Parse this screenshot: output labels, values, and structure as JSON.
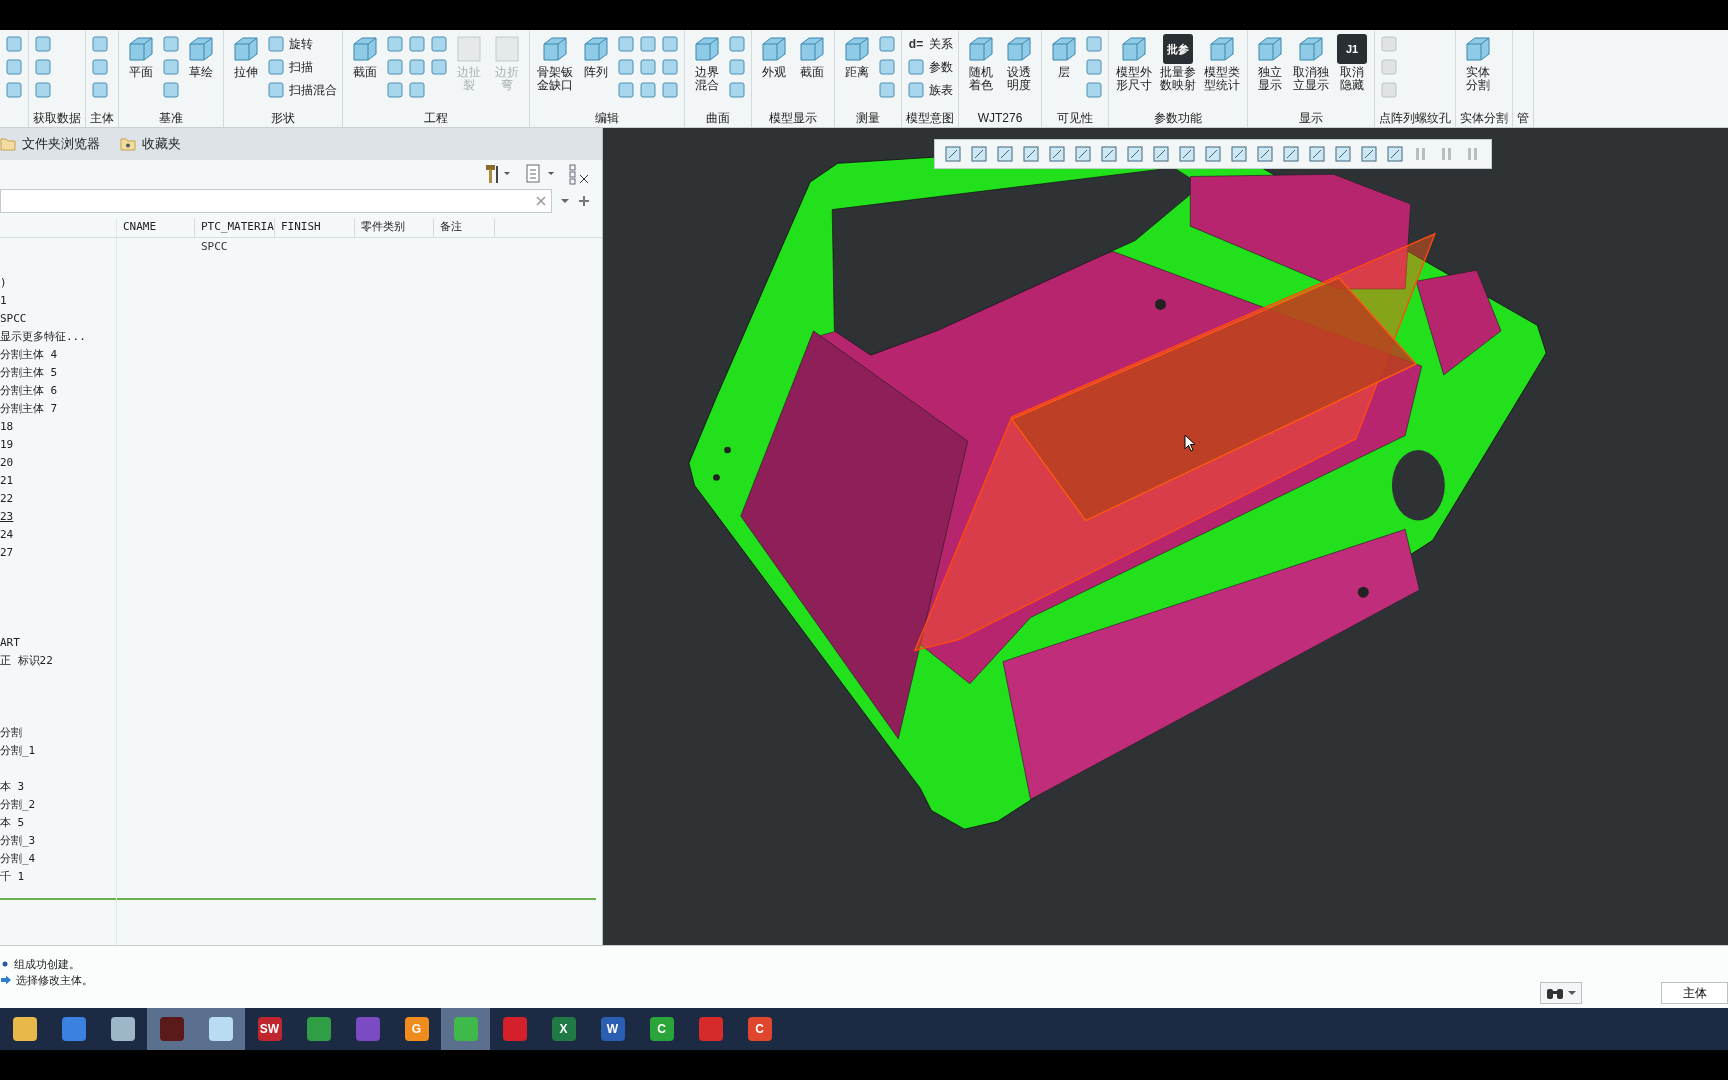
{
  "ribbon": {
    "groups": [
      {
        "items": [
          {
            "kind": "column",
            "entries": [
              {
                "kind": "icon"
              },
              {
                "kind": "icon"
              },
              {
                "kind": "icon"
              }
            ]
          }
        ]
      },
      {
        "label": "获取数据",
        "items": [
          {
            "kind": "column",
            "entries": [
              {
                "kind": "icon"
              },
              {
                "kind": "icon"
              },
              {
                "kind": "icon"
              }
            ]
          }
        ]
      },
      {
        "label": "主体",
        "items": [
          {
            "kind": "column",
            "entries": [
              {
                "kind": "icon"
              },
              {
                "kind": "icon"
              },
              {
                "kind": "icon"
              }
            ]
          }
        ]
      },
      {
        "label": "基准",
        "items": [
          {
            "kind": "large",
            "label": "平面"
          },
          {
            "kind": "column",
            "entries": [
              {
                "kind": "icon"
              },
              {
                "kind": "icon"
              },
              {
                "kind": "icon"
              }
            ]
          },
          {
            "kind": "large",
            "label": "草绘"
          }
        ]
      },
      {
        "label": "形状",
        "items": [
          {
            "kind": "large",
            "label": "拉伸"
          },
          {
            "kind": "column",
            "entries": [
              {
                "kind": "icon",
                "label": "旋转"
              },
              {
                "kind": "icon",
                "label": "扫描"
              },
              {
                "kind": "icon",
                "label": "扫描混合"
              }
            ]
          }
        ]
      },
      {
        "label": "工程",
        "items": [
          {
            "kind": "large",
            "label": "截面"
          },
          {
            "kind": "column",
            "entries": [
              {
                "kind": "icon"
              },
              {
                "kind": "icon"
              },
              {
                "kind": "icon"
              }
            ]
          },
          {
            "kind": "column",
            "entries": [
              {
                "kind": "icon"
              },
              {
                "kind": "icon"
              },
              {
                "kind": "icon"
              }
            ]
          },
          {
            "kind": "column",
            "entries": [
              {
                "kind": "icon"
              },
              {
                "kind": "icon"
              }
            ]
          },
          {
            "kind": "large",
            "label": "边扯裂",
            "disabled": true
          },
          {
            "kind": "large",
            "label": "边折弯",
            "disabled": true
          }
        ]
      },
      {
        "label": "编辑",
        "items": [
          {
            "kind": "large",
            "label": "骨架钣金缺口"
          },
          {
            "kind": "large",
            "label": "阵列"
          },
          {
            "kind": "column",
            "entries": [
              {
                "kind": "icon"
              },
              {
                "kind": "icon"
              },
              {
                "kind": "icon"
              }
            ]
          },
          {
            "kind": "column",
            "entries": [
              {
                "kind": "icon"
              },
              {
                "kind": "icon"
              },
              {
                "kind": "icon"
              }
            ]
          },
          {
            "kind": "column",
            "entries": [
              {
                "kind": "icon"
              },
              {
                "kind": "icon"
              },
              {
                "kind": "icon"
              }
            ]
          }
        ]
      },
      {
        "label": "曲面",
        "items": [
          {
            "kind": "large",
            "label": "边界混合"
          },
          {
            "kind": "column",
            "entries": [
              {
                "kind": "icon"
              },
              {
                "kind": "icon"
              },
              {
                "kind": "icon"
              }
            ]
          }
        ]
      },
      {
        "label": "模型显示",
        "items": [
          {
            "kind": "large",
            "label": "外观"
          },
          {
            "kind": "large",
            "label": "截面"
          }
        ]
      },
      {
        "label": "测量",
        "items": [
          {
            "kind": "large",
            "label": "距离"
          },
          {
            "kind": "column",
            "entries": [
              {
                "kind": "icon"
              },
              {
                "kind": "icon"
              },
              {
                "kind": "icon"
              }
            ]
          }
        ]
      },
      {
        "label": "模型意图",
        "items": [
          {
            "kind": "column",
            "entries": [
              {
                "kind": "icon",
                "glyph": "d=",
                "label": "关系"
              },
              {
                "kind": "icon",
                "label": "参数"
              },
              {
                "kind": "icon",
                "label": "族表"
              }
            ]
          }
        ]
      },
      {
        "label": "WJT276",
        "items": [
          {
            "kind": "large",
            "label": "随机着色"
          },
          {
            "kind": "large",
            "label": "设透明度"
          }
        ]
      },
      {
        "label": "可见性",
        "items": [
          {
            "kind": "large",
            "label": "层"
          },
          {
            "kind": "column",
            "entries": [
              {
                "kind": "icon"
              },
              {
                "kind": "icon"
              },
              {
                "kind": "icon"
              }
            ]
          }
        ]
      },
      {
        "label": "参数功能",
        "items": [
          {
            "kind": "large",
            "label": "模型外形尺寸"
          },
          {
            "kind": "large",
            "glyph": "批参",
            "label": "批量参数映射"
          },
          {
            "kind": "large",
            "label": "模型类型统计"
          }
        ]
      },
      {
        "label": "显示",
        "items": [
          {
            "kind": "large",
            "label": "独立显示"
          },
          {
            "kind": "large",
            "label": "取消独立显示"
          },
          {
            "kind": "large",
            "glyph": "J1",
            "label": "取消隐藏"
          }
        ]
      },
      {
        "label": "点阵列螺纹孔",
        "items": [
          {
            "kind": "column",
            "disabled": true,
            "entries": [
              {
                "kind": "icon"
              },
              {
                "kind": "icon"
              },
              {
                "kind": "icon"
              }
            ]
          }
        ]
      },
      {
        "label": "实体分割",
        "items": [
          {
            "kind": "large",
            "label": "实体分割"
          }
        ]
      },
      {
        "label": "管"
      }
    ]
  },
  "browser_tabs": [
    "文件夹浏览器",
    "收藏夹"
  ],
  "tree": {
    "columns": [
      "CNAME",
      "PTC_MATERIA",
      "FINISH",
      "零件类别",
      "备注"
    ],
    "rows": [
      {
        "kind": "item",
        "material": "SPCC"
      },
      {
        "kind": "blank"
      },
      {
        "kind": "item",
        "label": ")"
      },
      {
        "kind": "item",
        "label": "1"
      },
      {
        "kind": "item",
        "label": "SPCC"
      },
      {
        "kind": "item",
        "label": "显示更多特征..."
      },
      {
        "kind": "item",
        "label": "分割主体 4"
      },
      {
        "kind": "item",
        "label": "分割主体 5"
      },
      {
        "kind": "item",
        "label": "分割主体 6"
      },
      {
        "kind": "item",
        "label": "分割主体 7"
      },
      {
        "kind": "item",
        "label": "18"
      },
      {
        "kind": "item",
        "label": "19"
      },
      {
        "kind": "item",
        "label": "20"
      },
      {
        "kind": "item",
        "label": "21"
      },
      {
        "kind": "item",
        "label": "22"
      },
      {
        "kind": "item",
        "label": "23",
        "hovered": true
      },
      {
        "kind": "item",
        "label": "24"
      },
      {
        "kind": "item",
        "label": "27"
      },
      {
        "kind": "blank"
      },
      {
        "kind": "blank"
      },
      {
        "kind": "blank"
      },
      {
        "kind": "blank"
      },
      {
        "kind": "item",
        "label": "ART"
      },
      {
        "kind": "item",
        "label": "正 标识22"
      },
      {
        "kind": "blank"
      },
      {
        "kind": "blank"
      },
      {
        "kind": "blank"
      },
      {
        "kind": "item",
        "label": "分割"
      },
      {
        "kind": "item",
        "label": "分割_1"
      },
      {
        "kind": "blank"
      },
      {
        "kind": "item",
        "label": "本 3"
      },
      {
        "kind": "item",
        "label": "分割_2"
      },
      {
        "kind": "item",
        "label": "本 5"
      },
      {
        "kind": "item",
        "label": "分割_3"
      },
      {
        "kind": "item",
        "label": "分割_4"
      },
      {
        "kind": "item",
        "label": "千 1"
      }
    ]
  },
  "messages": [
    {
      "kind": "info",
      "text": "组成功创建。"
    },
    {
      "kind": "prompt",
      "text": "选择修改主体。"
    }
  ],
  "filter_field": {
    "value": "主体"
  },
  "taskbar": [
    {
      "color": "#e8b84a",
      "highlighted": false
    },
    {
      "color": "#3b82e0",
      "highlighted": false
    },
    {
      "color": "#9db7c9",
      "highlighted": false
    },
    {
      "color": "#5a1a1a",
      "highlighted": true
    },
    {
      "color": "#b9dcf2",
      "highlighted": true
    },
    {
      "color": "#c0262d",
      "highlighted": false,
      "glyph": "SW"
    },
    {
      "color": "#2f9e44",
      "highlighted": false
    },
    {
      "color": "#7b4bc4",
      "highlighted": false
    },
    {
      "color": "#f08c1e",
      "highlighted": false,
      "glyph": "G"
    },
    {
      "color": "#3fb94a",
      "highlighted": true
    },
    {
      "color": "#d3202a",
      "highlighted": false
    },
    {
      "color": "#1f7a45",
      "highlighted": false,
      "glyph": "X"
    },
    {
      "color": "#2b5fb4",
      "highlighted": false,
      "glyph": "W"
    },
    {
      "color": "#2aa53a",
      "highlighted": false,
      "glyph": "C"
    },
    {
      "color": "#d72a2a",
      "highlighted": false
    },
    {
      "color": "#e0452e",
      "highlighted": false,
      "glyph": "C"
    }
  ]
}
